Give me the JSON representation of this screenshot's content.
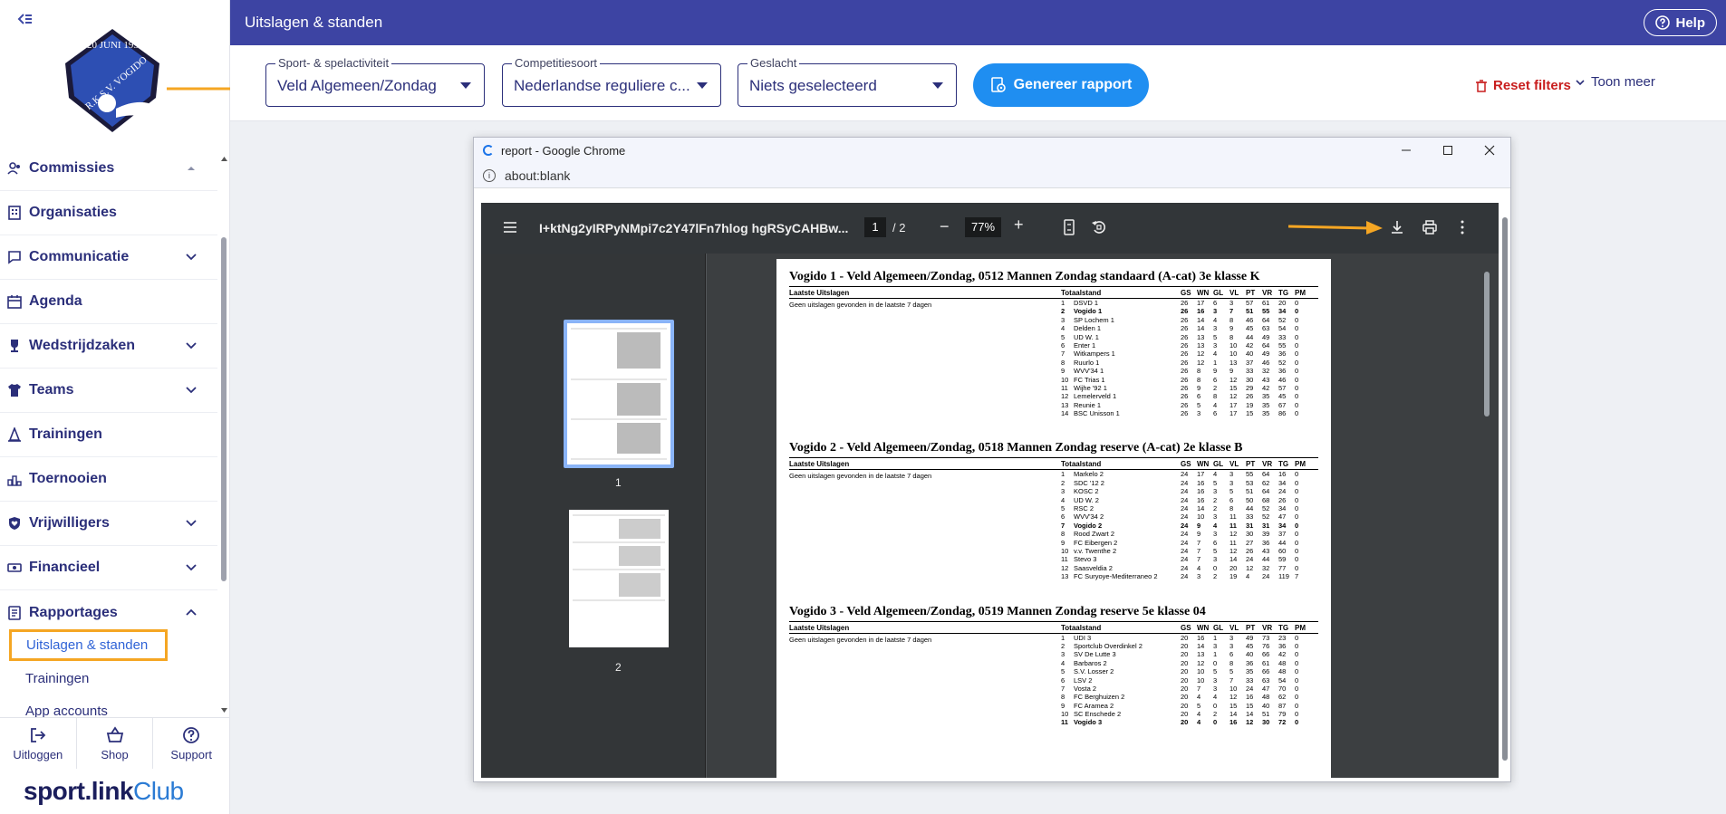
{
  "header": {
    "title": "Uitslagen & standen",
    "help_label": "Help"
  },
  "sidebar": {
    "nav": [
      {
        "label": "Commissies",
        "icon": "people-icon",
        "chevron": "up"
      },
      {
        "label": "Organisaties",
        "icon": "building-icon",
        "chevron": ""
      },
      {
        "label": "Communicatie",
        "icon": "chat-icon",
        "chevron": "down"
      },
      {
        "label": "Agenda",
        "icon": "calendar-icon",
        "chevron": ""
      },
      {
        "label": "Wedstrijdzaken",
        "icon": "trophy-icon",
        "chevron": "down"
      },
      {
        "label": "Teams",
        "icon": "shirt-icon",
        "chevron": "down"
      },
      {
        "label": "Trainingen",
        "icon": "cone-icon",
        "chevron": ""
      },
      {
        "label": "Toernooien",
        "icon": "podium-icon",
        "chevron": ""
      },
      {
        "label": "Vrijwilligers",
        "icon": "heart-shield-icon",
        "chevron": "down"
      },
      {
        "label": "Financieel",
        "icon": "money-icon",
        "chevron": "down"
      },
      {
        "label": "Rapportages",
        "icon": "report-icon",
        "chevron": "up"
      }
    ],
    "sub_items": {
      "active": "Uitslagen & standen",
      "trainingen": "Trainingen",
      "app_accounts": "App accounts"
    },
    "bottom": {
      "logout": "Uitloggen",
      "shop": "Shop",
      "support": "Support"
    },
    "brand": {
      "sport": "sport.link",
      "club": "Club"
    },
    "logo": {
      "top_text": "20 JUNI 1931",
      "name": "R.K.S.V. VOGIDO"
    }
  },
  "filters": {
    "sport": {
      "label": "Sport- & spelactiviteit",
      "value": "Veld Algemeen/Zondag"
    },
    "competitie": {
      "label": "Competitiesoort",
      "value": "Nederlandse reguliere c..."
    },
    "geslacht": {
      "label": "Geslacht",
      "value": "Niets geselecteerd"
    },
    "generate_label": "Genereer rapport",
    "reset_label": "Reset filters",
    "more_label": "Toon meer"
  },
  "browser": {
    "title": "report - Google Chrome",
    "address": "about:blank",
    "pdf": {
      "filename": "I+ktNg2yIRPyNMpi7c2Y47lFn7hlog hgRSyCAHBw...",
      "page_current": "1",
      "page_total": "/ 2",
      "zoom": "77%",
      "thumb_labels": [
        "1",
        "2"
      ]
    }
  },
  "report": {
    "headers": {
      "recent": "Laatste Uitslagen",
      "total": "Totaalstand",
      "cols": [
        "GS",
        "WN",
        "GL",
        "VL",
        "PT",
        "VR",
        "TG",
        "PM"
      ]
    },
    "sections": [
      {
        "title": "Vogido 1 - Veld Algemeen/Zondag, 0512 Mannen Zondag standaard (A-cat) 3e klasse K",
        "none_text": "Geen uitslagen gevonden in de laatste 7 dagen",
        "rows": [
          [
            "1",
            "DSVD 1",
            "26",
            "17",
            "6",
            "3",
            "57",
            "61",
            "20",
            "0"
          ],
          [
            "2",
            "Vogido 1",
            "26",
            "16",
            "3",
            "7",
            "51",
            "55",
            "34",
            "0"
          ],
          [
            "3",
            "SP Lochem 1",
            "26",
            "14",
            "4",
            "8",
            "46",
            "64",
            "52",
            "0"
          ],
          [
            "4",
            "Delden 1",
            "26",
            "14",
            "3",
            "9",
            "45",
            "63",
            "54",
            "0"
          ],
          [
            "5",
            "UD W. 1",
            "26",
            "13",
            "5",
            "8",
            "44",
            "49",
            "33",
            "0"
          ],
          [
            "6",
            "Enter 1",
            "26",
            "13",
            "3",
            "10",
            "42",
            "64",
            "55",
            "0"
          ],
          [
            "7",
            "Witkampers 1",
            "26",
            "12",
            "4",
            "10",
            "40",
            "49",
            "36",
            "0"
          ],
          [
            "8",
            "Ruurlo 1",
            "26",
            "12",
            "1",
            "13",
            "37",
            "46",
            "52",
            "0"
          ],
          [
            "9",
            "WVV'34 1",
            "26",
            "8",
            "9",
            "9",
            "33",
            "32",
            "36",
            "0"
          ],
          [
            "10",
            "FC Trias 1",
            "26",
            "8",
            "6",
            "12",
            "30",
            "43",
            "46",
            "0"
          ],
          [
            "11",
            "Wijhe '92 1",
            "26",
            "9",
            "2",
            "15",
            "29",
            "42",
            "57",
            "0"
          ],
          [
            "12",
            "Lemelerveld 1",
            "26",
            "6",
            "8",
            "12",
            "26",
            "35",
            "45",
            "0"
          ],
          [
            "13",
            "Reunie 1",
            "26",
            "5",
            "4",
            "17",
            "19",
            "35",
            "67",
            "0"
          ],
          [
            "14",
            "BSC Unisson 1",
            "26",
            "3",
            "6",
            "17",
            "15",
            "35",
            "86",
            "0"
          ]
        ],
        "bold_row": 1
      },
      {
        "title": "Vogido 2 - Veld Algemeen/Zondag, 0518 Mannen Zondag reserve (A-cat) 2e klasse B",
        "none_text": "Geen uitslagen gevonden in de laatste 7 dagen",
        "rows": [
          [
            "1",
            "Markelo 2",
            "24",
            "17",
            "4",
            "3",
            "55",
            "64",
            "16",
            "0"
          ],
          [
            "2",
            "SDC '12 2",
            "24",
            "16",
            "5",
            "3",
            "53",
            "62",
            "34",
            "0"
          ],
          [
            "3",
            "KOSC 2",
            "24",
            "16",
            "3",
            "5",
            "51",
            "64",
            "24",
            "0"
          ],
          [
            "4",
            "UD W. 2",
            "24",
            "16",
            "2",
            "6",
            "50",
            "68",
            "26",
            "0"
          ],
          [
            "5",
            "RSC 2",
            "24",
            "14",
            "2",
            "8",
            "44",
            "52",
            "34",
            "0"
          ],
          [
            "6",
            "WVV'34 2",
            "24",
            "10",
            "3",
            "11",
            "33",
            "52",
            "47",
            "0"
          ],
          [
            "7",
            "Vogido 2",
            "24",
            "9",
            "4",
            "11",
            "31",
            "31",
            "34",
            "0"
          ],
          [
            "8",
            "Rood Zwart 2",
            "24",
            "9",
            "3",
            "12",
            "30",
            "39",
            "37",
            "0"
          ],
          [
            "9",
            "FC Eibergen 2",
            "24",
            "7",
            "6",
            "11",
            "27",
            "36",
            "44",
            "0"
          ],
          [
            "10",
            "v.v. Twenthe 2",
            "24",
            "7",
            "5",
            "12",
            "26",
            "43",
            "60",
            "0"
          ],
          [
            "11",
            "Stevo 3",
            "24",
            "7",
            "3",
            "14",
            "24",
            "44",
            "59",
            "0"
          ],
          [
            "12",
            "Saasveldia 2",
            "24",
            "4",
            "0",
            "20",
            "12",
            "32",
            "77",
            "0"
          ],
          [
            "13",
            "FC Suryoye-Mediterraneo 2",
            "24",
            "3",
            "2",
            "19",
            "4",
            "24",
            "119",
            "7"
          ]
        ],
        "bold_row": 6
      },
      {
        "title": "Vogido 3 - Veld Algemeen/Zondag, 0519 Mannen Zondag reserve 5e klasse 04",
        "none_text": "Geen uitslagen gevonden in de laatste 7 dagen",
        "rows": [
          [
            "1",
            "UDI 3",
            "20",
            "16",
            "1",
            "3",
            "49",
            "73",
            "23",
            "0"
          ],
          [
            "2",
            "Sportclub Overdinkel 2",
            "20",
            "14",
            "3",
            "3",
            "45",
            "76",
            "36",
            "0"
          ],
          [
            "3",
            "SV De Lutte 3",
            "20",
            "13",
            "1",
            "6",
            "40",
            "66",
            "42",
            "0"
          ],
          [
            "4",
            "Barbaros 2",
            "20",
            "12",
            "0",
            "8",
            "36",
            "61",
            "48",
            "0"
          ],
          [
            "5",
            "S.V. Losser 2",
            "20",
            "10",
            "5",
            "5",
            "35",
            "66",
            "48",
            "0"
          ],
          [
            "6",
            "LSV 2",
            "20",
            "10",
            "3",
            "7",
            "33",
            "63",
            "54",
            "0"
          ],
          [
            "7",
            "Vosta 2",
            "20",
            "7",
            "3",
            "10",
            "24",
            "47",
            "70",
            "0"
          ],
          [
            "8",
            "FC Berghuizen 2",
            "20",
            "4",
            "4",
            "12",
            "16",
            "48",
            "62",
            "0"
          ],
          [
            "9",
            "FC Aramea 2",
            "20",
            "5",
            "0",
            "15",
            "15",
            "40",
            "87",
            "0"
          ],
          [
            "10",
            "SC Enschede 2",
            "20",
            "4",
            "2",
            "14",
            "14",
            "51",
            "79",
            "0"
          ],
          [
            "11",
            "Vogido 3",
            "20",
            "4",
            "0",
            "16",
            "12",
            "30",
            "72",
            "0"
          ]
        ],
        "bold_row": 10
      }
    ]
  }
}
